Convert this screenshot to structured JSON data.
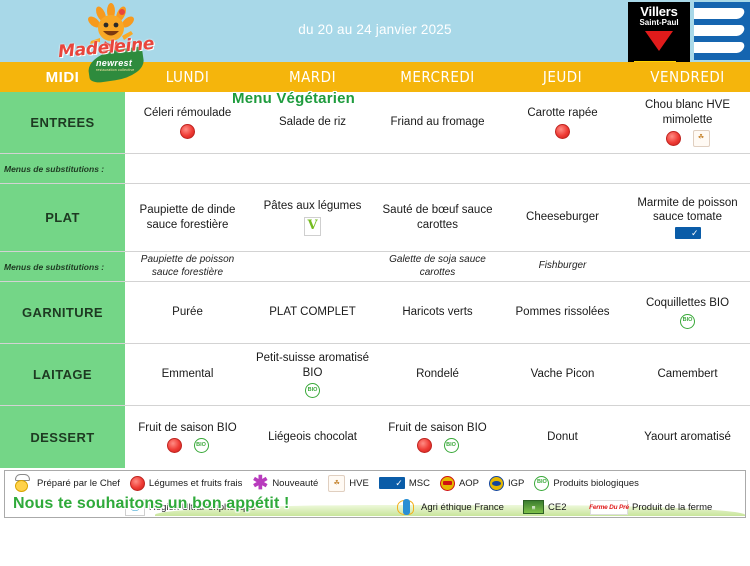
{
  "header": {
    "logo_name": "Madeleine",
    "logo_sub": "newrest",
    "logo_tagline": "restauration collective",
    "date_range": "du 20 au 24 janvier 2025",
    "city_logo_name": "Villers",
    "city_logo_sub": "Saint-Paul"
  },
  "days": {
    "service_label": "MIDI",
    "list": [
      "LUNDI",
      "MARDI",
      "MERCREDI",
      "JEUDI",
      "VENDREDI"
    ]
  },
  "veg_banner": "Menu Végétarien",
  "rows": {
    "entrees_label": "ENTREES",
    "plat_label": "PLAT",
    "garniture_label": "GARNITURE",
    "laitage_label": "LAITAGE",
    "dessert_label": "DESSERT",
    "substitution_label": "Menus de substitutions :"
  },
  "menu": {
    "entrees": [
      {
        "text": "Céleri rémoulade",
        "icons": [
          "fresh"
        ]
      },
      {
        "text": "Salade de riz",
        "icons": []
      },
      {
        "text": "Friand au fromage",
        "icons": []
      },
      {
        "text": "Carotte rapée",
        "icons": [
          "fresh"
        ]
      },
      {
        "text": "Chou blanc HVE mimolette",
        "icons": [
          "fresh",
          "hve"
        ]
      }
    ],
    "entrees_sub": [
      "",
      "",
      "",
      "",
      ""
    ],
    "plat": [
      {
        "text": "Paupiette de dinde sauce forestière",
        "icons": []
      },
      {
        "text": "Pâtes aux légumes",
        "icons": [
          "veg"
        ]
      },
      {
        "text": "Sauté de bœuf sauce carottes",
        "icons": []
      },
      {
        "text": "Cheeseburger",
        "icons": []
      },
      {
        "text": "Marmite de poisson sauce tomate",
        "icons": [
          "msc"
        ]
      }
    ],
    "plat_sub": [
      "Paupiette de poisson sauce forestière",
      "",
      "Galette de soja sauce carottes",
      "Fishburger",
      ""
    ],
    "garniture": [
      {
        "text": "Purée",
        "icons": []
      },
      {
        "text": "PLAT COMPLET",
        "icons": []
      },
      {
        "text": "Haricots verts",
        "icons": []
      },
      {
        "text": "Pommes rissolées",
        "icons": []
      },
      {
        "text": "Coquillettes BIO",
        "icons": [
          "bio"
        ]
      }
    ],
    "laitage": [
      {
        "text": "Emmental",
        "icons": []
      },
      {
        "text": "Petit-suisse aromatisé BIO",
        "icons": [
          "bio"
        ]
      },
      {
        "text": "Rondelé",
        "icons": []
      },
      {
        "text": "Vache Picon",
        "icons": []
      },
      {
        "text": "Camembert",
        "icons": []
      }
    ],
    "dessert": [
      {
        "text": "Fruit de saison BIO",
        "icons": [
          "fresh",
          "bio"
        ]
      },
      {
        "text": "Liégeois chocolat",
        "icons": []
      },
      {
        "text": "Fruit de saison BIO",
        "icons": [
          "fresh",
          "bio"
        ]
      },
      {
        "text": "Donut",
        "icons": []
      },
      {
        "text": "Yaourt aromatisé",
        "icons": []
      }
    ]
  },
  "footer": {
    "legend_top": [
      {
        "icon": "chef-icon",
        "label": "Préparé par le Chef"
      },
      {
        "icon": "fresh-icon",
        "label": "Légumes et fruits frais"
      },
      {
        "icon": "new-icon",
        "label": "Nouveauté"
      },
      {
        "icon": "hve-icon",
        "label": "HVE"
      },
      {
        "icon": "msc-icon",
        "label": "MSC"
      },
      {
        "icon": "aop-icon",
        "label": "AOP"
      },
      {
        "icon": "igp-icon",
        "label": "IGP"
      },
      {
        "icon": "bio-icon",
        "label": "Produits biologiques"
      }
    ],
    "legend_bottom": [
      {
        "icon": "region-icon",
        "label": "Région UltraPériphérique"
      },
      {
        "icon": "agri-icon",
        "label": "Agri éthique France"
      },
      {
        "icon": "ce2-icon",
        "label": "CE2"
      },
      {
        "icon": "ferme-icon",
        "label": "Produit de la ferme"
      }
    ],
    "ferme_logo_text": "Ferme Du Pré",
    "ce2_logo_text": "CE2",
    "appetit": "Nous te souhaitons un bon appétit !"
  },
  "colors": {
    "header_blue": "#a8d8e8",
    "days_amber": "#f5b50c",
    "row_green": "#74d687",
    "veg_green": "#1f9c3e",
    "fresh_red": "#ef3b35",
    "bio_green": "#3aa93a"
  }
}
